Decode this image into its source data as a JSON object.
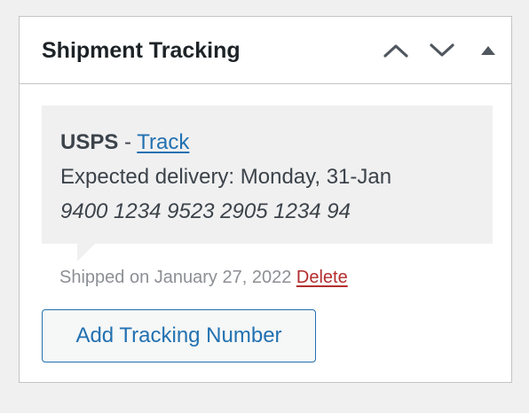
{
  "metabox": {
    "title": "Shipment Tracking",
    "controls": {
      "move_up_icon": "chevron-up-icon",
      "move_down_icon": "chevron-down-icon",
      "toggle_icon": "triangle-up-icon"
    }
  },
  "tracking": {
    "provider": "USPS",
    "separator": " - ",
    "track_label": "Track",
    "expected_delivery": "Expected delivery: Monday, 31-Jan",
    "tracking_number": "9400 1234 9523 2905 1234 94"
  },
  "meta": {
    "shipped_on": "Shipped on January 27, 2022",
    "delete_label": "Delete"
  },
  "actions": {
    "add_label": "Add Tracking Number"
  },
  "colors": {
    "link": "#2271b1",
    "delete": "#b32d2e",
    "note_background": "#f0f0f1",
    "border": "#c3c4c7"
  }
}
